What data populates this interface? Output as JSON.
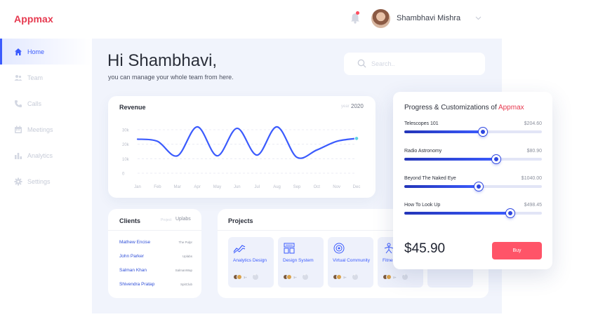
{
  "app": {
    "logo": "Appmax"
  },
  "sidebar": {
    "items": [
      {
        "label": "Home",
        "icon": "home-icon",
        "active": true
      },
      {
        "label": "Team",
        "icon": "team-icon"
      },
      {
        "label": "Calls",
        "icon": "phone-icon"
      },
      {
        "label": "Meetings",
        "icon": "calendar-icon"
      },
      {
        "label": "Analytics",
        "icon": "bar-chart-icon"
      },
      {
        "label": "Settings",
        "icon": "gear-icon"
      }
    ]
  },
  "header": {
    "user_name": "Shambhavi Mishra"
  },
  "greeting": {
    "hi": "Hi",
    "name": "Shambhavi,",
    "subtitle": "you can manage your whole team from here."
  },
  "search": {
    "placeholder": "Search.."
  },
  "revenue": {
    "title": "Revenue",
    "year_label": "year",
    "year": "2020",
    "chart_data": {
      "type": "line",
      "title": "Revenue",
      "categories": [
        "Jan",
        "Feb",
        "Mar",
        "Apr",
        "May",
        "Jun",
        "Jul",
        "Aug",
        "Sep",
        "Oct",
        "Nov",
        "Dec"
      ],
      "y_ticks": [
        "30k",
        "20k",
        "10k",
        "0"
      ],
      "ylim": [
        0,
        30000
      ],
      "series": [
        {
          "values": [
            23500,
            22000,
            12000,
            32000,
            12000,
            31000,
            12500,
            32000,
            11000,
            16000,
            22000,
            24000
          ]
        }
      ],
      "grid": true,
      "color": "#3b5bfd"
    }
  },
  "clients": {
    "title": "Clients",
    "project_label": "Project",
    "project_value": "Uplabs",
    "rows": [
      {
        "name": "Mathew Encise",
        "company": "The Pulpr"
      },
      {
        "name": "John Parker",
        "company": "Uplabs"
      },
      {
        "name": "Salman Khan",
        "company": "SalmanWap"
      },
      {
        "name": "Shivendra Pratap",
        "company": "SpitClub"
      }
    ]
  },
  "projects": {
    "title": "Projects",
    "tiles": [
      {
        "name": "Analytics Design",
        "icon": "analytics-icon",
        "extra": "3+"
      },
      {
        "name": "Design System",
        "icon": "design-system-icon",
        "extra": "3+"
      },
      {
        "name": "Virtual Community",
        "icon": "community-icon",
        "extra": "3+"
      },
      {
        "name": "Fitness App",
        "icon": "fitness-icon",
        "extra": "3+"
      }
    ]
  },
  "progress": {
    "title": "Progress & Customizations of",
    "brand": "Appmax",
    "items": [
      {
        "label": "Telescopes 101",
        "value": "$204.60",
        "percent": 57
      },
      {
        "label": "Radio Astronomy",
        "value": "$80.90",
        "percent": 67
      },
      {
        "label": "Beyond The Naked Eye",
        "value": "$1040.00",
        "percent": 54
      },
      {
        "label": "How To Look Up",
        "value": "$498.45",
        "percent": 77
      }
    ],
    "price": "$45.90",
    "buy_label": "Buy"
  },
  "colors": {
    "brand": "#e6394f",
    "accent": "#3b5bfd",
    "buy": "#ff5468"
  }
}
